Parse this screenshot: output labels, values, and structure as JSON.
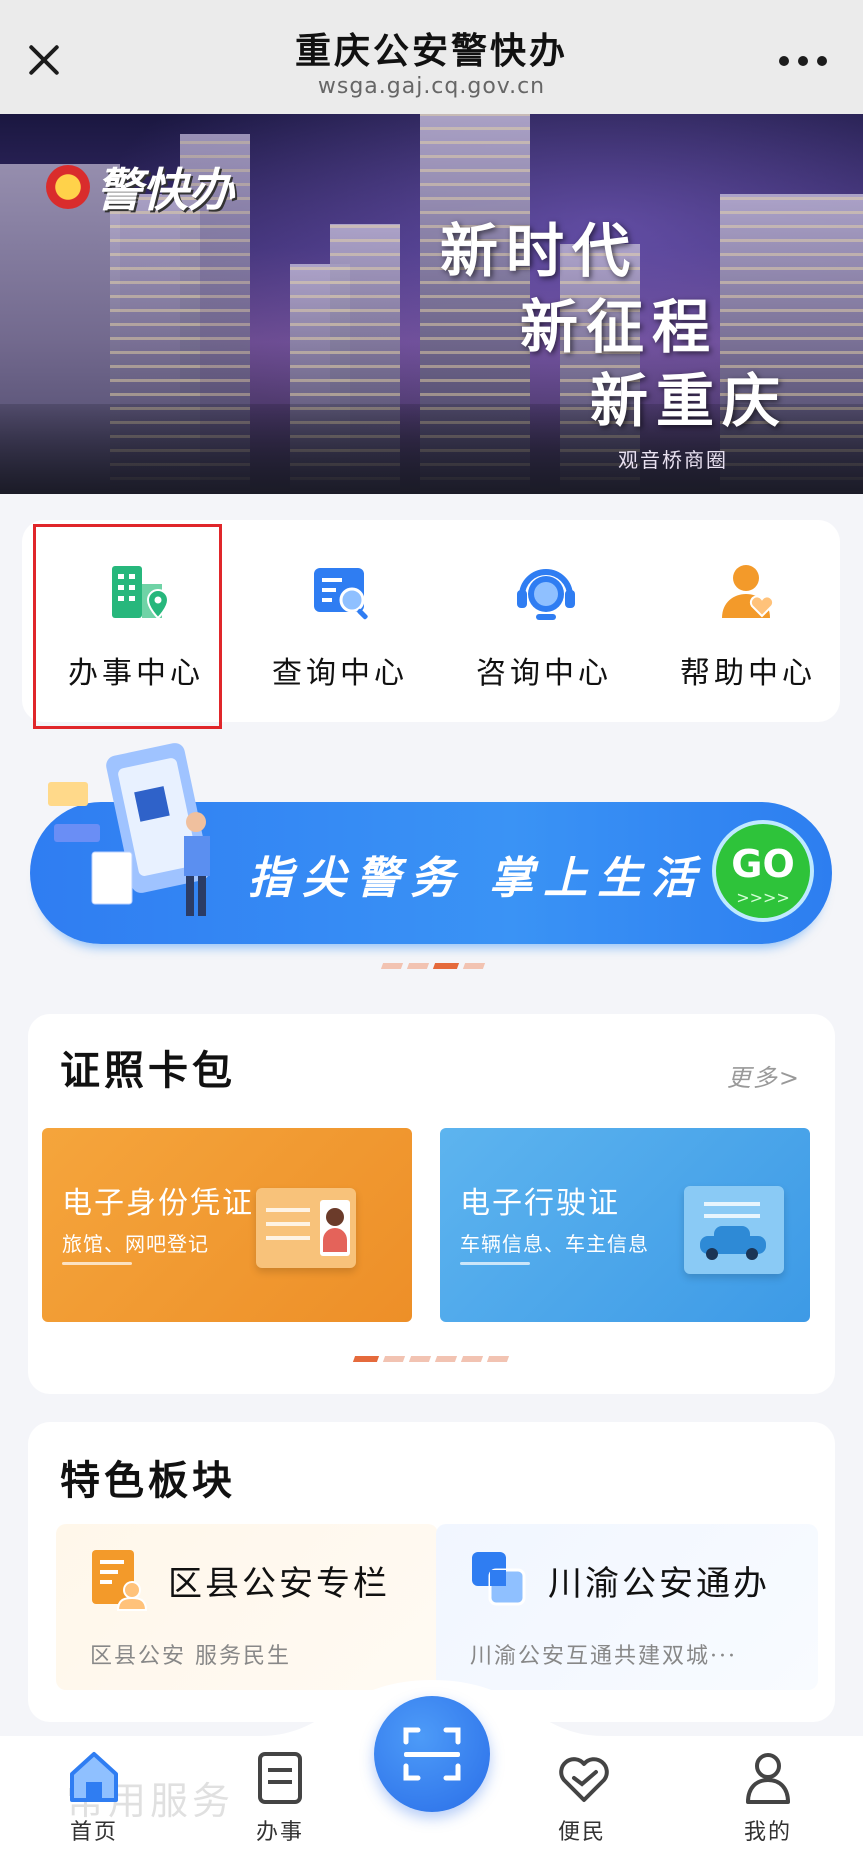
{
  "topbar": {
    "title": "重庆公安警快办",
    "url": "wsga.gaj.cq.gov.cn",
    "close_icon": "close-icon",
    "more_icon": "more-dots-icon"
  },
  "banner": {
    "logo_text": "警快办",
    "slogan": [
      "新时代",
      "新征程",
      "新重庆"
    ],
    "caption": "观音桥商圈"
  },
  "services": [
    {
      "label": "办事中心",
      "icon": "office-building-pin-icon",
      "color": "#27b77c"
    },
    {
      "label": "查询中心",
      "icon": "search-document-icon",
      "color": "#2f7df2"
    },
    {
      "label": "咨询中心",
      "icon": "headset-icon",
      "color": "#2f7df2"
    },
    {
      "label": "帮助中心",
      "icon": "person-heart-icon",
      "color": "#f39a2a"
    }
  ],
  "promo": {
    "text": "指尖警务 掌上生活",
    "go_label": "GO",
    "go_arrows": ">>>>"
  },
  "certs": {
    "title": "证照卡包",
    "more": "更多>",
    "items": [
      {
        "name": "电子身份凭证",
        "desc": "旅馆、网吧登记",
        "color": "#f09a30"
      },
      {
        "name": "电子行驶证",
        "desc": "车辆信息、车主信息",
        "color": "#4aa6ea"
      }
    ]
  },
  "features": {
    "title": "特色板块",
    "items": [
      {
        "name": "区县公安专栏",
        "desc": "区县公安 服务民生",
        "icon": "document-person-icon"
      },
      {
        "name": "川渝公安通办",
        "desc": "川渝公安互通共建双城···",
        "icon": "overlap-squares-icon"
      }
    ]
  },
  "ghost_section": "常用服务",
  "nav": {
    "items": [
      {
        "label": "首页",
        "icon": "home-icon",
        "active": true
      },
      {
        "label": "办事",
        "icon": "document-list-icon"
      },
      {
        "label": "便民",
        "icon": "heart-icon"
      },
      {
        "label": "我的",
        "icon": "user-icon"
      }
    ],
    "scan_icon": "scan-icon"
  },
  "colors": {
    "accent_blue": "#2f7df2",
    "highlight_red": "#e0262a",
    "active_dot": "#e56a3c"
  }
}
